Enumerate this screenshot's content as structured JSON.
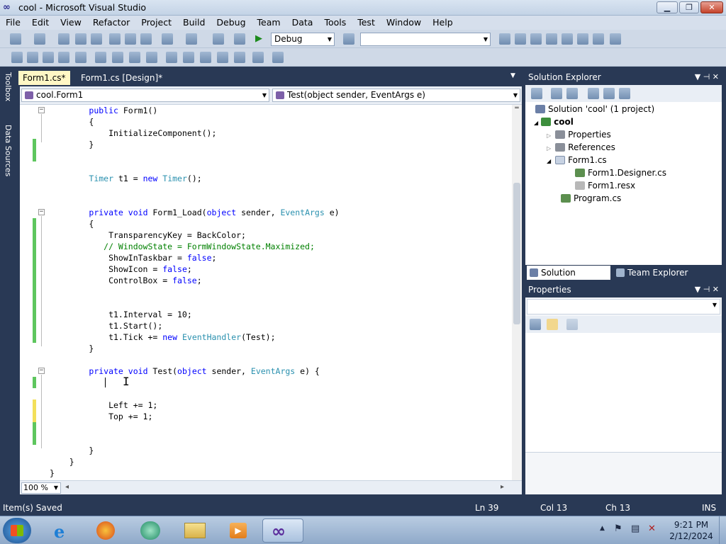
{
  "window": {
    "title": "cool - Microsoft Visual Studio"
  },
  "menu": [
    "File",
    "Edit",
    "View",
    "Refactor",
    "Project",
    "Build",
    "Debug",
    "Team",
    "Data",
    "Tools",
    "Test",
    "Window",
    "Help"
  ],
  "toolbar": {
    "config": "Debug",
    "platform": ""
  },
  "side_tabs": {
    "toolbox": "Toolbox",
    "data_sources": "Data Sources"
  },
  "doc_tabs": [
    {
      "label": "Form1.cs*"
    },
    {
      "label": "Form1.cs [Design]*"
    }
  ],
  "nav": {
    "type": "cool.Form1",
    "member": "Test(object sender, EventArgs e)"
  },
  "zoom": "100 %",
  "solution": {
    "header": "Solution Explorer",
    "items": [
      {
        "label": "Solution 'cool' (1 project)"
      },
      {
        "label": "cool"
      },
      {
        "label": "Properties"
      },
      {
        "label": "References"
      },
      {
        "label": "Form1.cs"
      },
      {
        "label": "Form1.Designer.cs"
      },
      {
        "label": "Form1.resx"
      },
      {
        "label": "Program.cs"
      }
    ],
    "tabs": [
      {
        "label": "Solution Explorer"
      },
      {
        "label": "Team Explorer"
      }
    ]
  },
  "properties": {
    "header": "Properties"
  },
  "status": {
    "message": "Item(s) Saved",
    "ln": "Ln 39",
    "col": "Col 13",
    "ch": "Ch 13",
    "mode": "INS"
  },
  "clock": {
    "time": "9:21 PM",
    "date": "2/12/2024"
  },
  "code_lines": [
    "        public Form1()",
    "        {",
    "            InitializeComponent();",
    "        }",
    "",
    "",
    "        Timer t1 = new Timer();",
    "",
    "",
    "        private void Form1_Load(object sender, EventArgs e)",
    "        {",
    "            TransparencyKey = BackColor;",
    "           // WindowState = FormWindowState.Maximized;",
    "            ShowInTaskbar = false;",
    "            ShowIcon = false;",
    "            ControlBox = false;",
    "",
    "",
    "            t1.Interval = 10;",
    "            t1.Start();",
    "            t1.Tick += new EventHandler(Test);",
    "        }",
    "",
    "        private void Test(object sender, EventArgs e) {",
    "",
    "",
    "            Left += 1;",
    "            Top += 1;",
    "",
    "",
    "        }",
    "    }",
    "}"
  ]
}
